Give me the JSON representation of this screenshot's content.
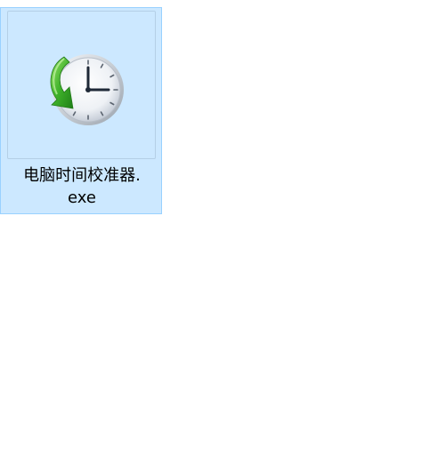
{
  "file": {
    "name_line1": "电脑时间校准器.",
    "name_line2": "exe",
    "icon": "clock-sync-icon",
    "state": "selected"
  },
  "colors": {
    "selection_fill": "#cce8ff",
    "selection_border": "#99d1ff",
    "background": "#ffffff"
  }
}
